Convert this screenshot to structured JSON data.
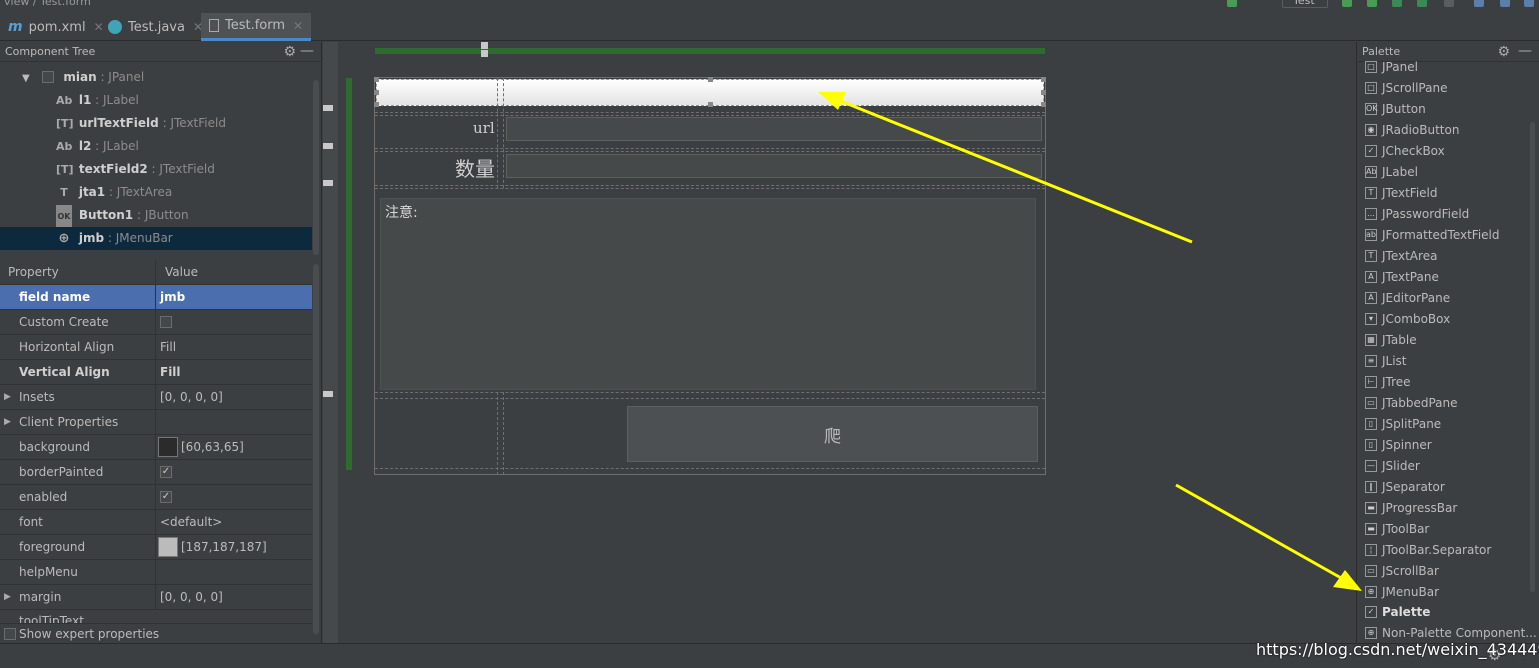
{
  "topbar": {
    "breadcrumb": "view / Test.form",
    "run_config": "Test"
  },
  "tabs": [
    {
      "label": "pom.xml",
      "icon": "maven-icon"
    },
    {
      "label": "Test.java",
      "icon": "java-class-icon"
    },
    {
      "label": "Test.form",
      "icon": "form-file-icon",
      "active": true
    }
  ],
  "component_tree": {
    "title": "Component Tree",
    "items": [
      {
        "name": "mian",
        "type": ": JPanel",
        "icon": "panel-icon"
      },
      {
        "name": "l1",
        "type": ": JLabel",
        "icon": "Ab"
      },
      {
        "name": "urlTextField",
        "type": ": JTextField",
        "icon": "textfield-icon"
      },
      {
        "name": "l2",
        "type": ": JLabel",
        "icon": "Ab"
      },
      {
        "name": "textField2",
        "type": ": JTextField",
        "icon": "textfield-icon"
      },
      {
        "name": "jta1",
        "type": ": JTextArea",
        "icon": "T"
      },
      {
        "name": "Button1",
        "type": ": JButton",
        "icon": "OK"
      },
      {
        "name": "jmb",
        "type": ": JMenuBar",
        "icon": "menubar-icon",
        "selected": true
      }
    ]
  },
  "properties": {
    "header": {
      "property": "Property",
      "value": "Value"
    },
    "rows": [
      {
        "name": "field name",
        "value": "jmb",
        "selected": true
      },
      {
        "name": "Custom Create",
        "value": "",
        "checkbox": false
      },
      {
        "name": "Horizontal Align",
        "value": "Fill"
      },
      {
        "name": "Vertical Align",
        "value": "Fill",
        "bold": true
      },
      {
        "name": "Insets",
        "value": "[0, 0, 0, 0]",
        "expandable": true
      },
      {
        "name": "Client Properties",
        "value": "",
        "expandable": true
      },
      {
        "name": "background",
        "value": "[60,63,65]",
        "swatch": "#3c3f41"
      },
      {
        "name": "borderPainted",
        "value": "✓",
        "checkbox": true
      },
      {
        "name": "enabled",
        "value": "✓",
        "checkbox": true
      },
      {
        "name": "font",
        "value": "<default>"
      },
      {
        "name": "foreground",
        "value": "[187,187,187]",
        "swatch": "#bbbbbb"
      },
      {
        "name": "helpMenu",
        "value": ""
      },
      {
        "name": "margin",
        "value": "[0, 0, 0, 0]",
        "expandable": true
      },
      {
        "name": "toolTipText",
        "value": ""
      }
    ],
    "expert_label": "Show expert properties"
  },
  "form": {
    "url_label": "url",
    "count_label": "数量",
    "note_text": "注意:",
    "button_label": "爬"
  },
  "palette": {
    "title": "Palette",
    "items": [
      {
        "label": "JPanel",
        "icon": "□"
      },
      {
        "label": "JScrollPane",
        "icon": "□"
      },
      {
        "label": "JButton",
        "icon": "OK"
      },
      {
        "label": "JRadioButton",
        "icon": "◉"
      },
      {
        "label": "JCheckBox",
        "icon": "✓"
      },
      {
        "label": "JLabel",
        "icon": "Ab"
      },
      {
        "label": "JTextField",
        "icon": "T"
      },
      {
        "label": "JPasswordField",
        "icon": "…"
      },
      {
        "label": "JFormattedTextField",
        "icon": "ab"
      },
      {
        "label": "JTextArea",
        "icon": "T"
      },
      {
        "label": "JTextPane",
        "icon": "A"
      },
      {
        "label": "JEditorPane",
        "icon": "A"
      },
      {
        "label": "JComboBox",
        "icon": "▾"
      },
      {
        "label": "JTable",
        "icon": "▦"
      },
      {
        "label": "JList",
        "icon": "≡"
      },
      {
        "label": "JTree",
        "icon": "⊢"
      },
      {
        "label": "JTabbedPane",
        "icon": "▭"
      },
      {
        "label": "JSplitPane",
        "icon": "▯"
      },
      {
        "label": "JSpinner",
        "icon": "▯"
      },
      {
        "label": "JSlider",
        "icon": "—"
      },
      {
        "label": "JSeparator",
        "icon": "‖"
      },
      {
        "label": "JProgressBar",
        "icon": "▬"
      },
      {
        "label": "JToolBar",
        "icon": "▬"
      },
      {
        "label": "JToolBar.Separator",
        "icon": "¦"
      },
      {
        "label": "JScrollBar",
        "icon": "▭"
      },
      {
        "label": "JMenuBar",
        "icon": "⊕"
      }
    ],
    "group_label": "Palette",
    "non_palette_label": "Non-Palette Component..."
  },
  "watermark": "https://blog.csdn.net/weixin_43444930",
  "colors": {
    "accent": "#4b6eaf",
    "green": "#2e6b2e",
    "arrow": "#ffff00"
  }
}
